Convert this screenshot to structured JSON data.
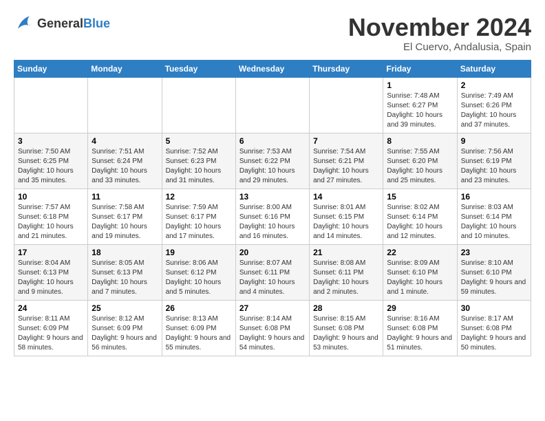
{
  "header": {
    "logo_general": "General",
    "logo_blue": "Blue",
    "month_year": "November 2024",
    "location": "El Cuervo, Andalusia, Spain"
  },
  "weekdays": [
    "Sunday",
    "Monday",
    "Tuesday",
    "Wednesday",
    "Thursday",
    "Friday",
    "Saturday"
  ],
  "weeks": [
    [
      {
        "day": "",
        "sunrise": "",
        "sunset": "",
        "daylight": ""
      },
      {
        "day": "",
        "sunrise": "",
        "sunset": "",
        "daylight": ""
      },
      {
        "day": "",
        "sunrise": "",
        "sunset": "",
        "daylight": ""
      },
      {
        "day": "",
        "sunrise": "",
        "sunset": "",
        "daylight": ""
      },
      {
        "day": "",
        "sunrise": "",
        "sunset": "",
        "daylight": ""
      },
      {
        "day": "1",
        "sunrise": "Sunrise: 7:48 AM",
        "sunset": "Sunset: 6:27 PM",
        "daylight": "Daylight: 10 hours and 39 minutes."
      },
      {
        "day": "2",
        "sunrise": "Sunrise: 7:49 AM",
        "sunset": "Sunset: 6:26 PM",
        "daylight": "Daylight: 10 hours and 37 minutes."
      }
    ],
    [
      {
        "day": "3",
        "sunrise": "Sunrise: 7:50 AM",
        "sunset": "Sunset: 6:25 PM",
        "daylight": "Daylight: 10 hours and 35 minutes."
      },
      {
        "day": "4",
        "sunrise": "Sunrise: 7:51 AM",
        "sunset": "Sunset: 6:24 PM",
        "daylight": "Daylight: 10 hours and 33 minutes."
      },
      {
        "day": "5",
        "sunrise": "Sunrise: 7:52 AM",
        "sunset": "Sunset: 6:23 PM",
        "daylight": "Daylight: 10 hours and 31 minutes."
      },
      {
        "day": "6",
        "sunrise": "Sunrise: 7:53 AM",
        "sunset": "Sunset: 6:22 PM",
        "daylight": "Daylight: 10 hours and 29 minutes."
      },
      {
        "day": "7",
        "sunrise": "Sunrise: 7:54 AM",
        "sunset": "Sunset: 6:21 PM",
        "daylight": "Daylight: 10 hours and 27 minutes."
      },
      {
        "day": "8",
        "sunrise": "Sunrise: 7:55 AM",
        "sunset": "Sunset: 6:20 PM",
        "daylight": "Daylight: 10 hours and 25 minutes."
      },
      {
        "day": "9",
        "sunrise": "Sunrise: 7:56 AM",
        "sunset": "Sunset: 6:19 PM",
        "daylight": "Daylight: 10 hours and 23 minutes."
      }
    ],
    [
      {
        "day": "10",
        "sunrise": "Sunrise: 7:57 AM",
        "sunset": "Sunset: 6:18 PM",
        "daylight": "Daylight: 10 hours and 21 minutes."
      },
      {
        "day": "11",
        "sunrise": "Sunrise: 7:58 AM",
        "sunset": "Sunset: 6:17 PM",
        "daylight": "Daylight: 10 hours and 19 minutes."
      },
      {
        "day": "12",
        "sunrise": "Sunrise: 7:59 AM",
        "sunset": "Sunset: 6:17 PM",
        "daylight": "Daylight: 10 hours and 17 minutes."
      },
      {
        "day": "13",
        "sunrise": "Sunrise: 8:00 AM",
        "sunset": "Sunset: 6:16 PM",
        "daylight": "Daylight: 10 hours and 16 minutes."
      },
      {
        "day": "14",
        "sunrise": "Sunrise: 8:01 AM",
        "sunset": "Sunset: 6:15 PM",
        "daylight": "Daylight: 10 hours and 14 minutes."
      },
      {
        "day": "15",
        "sunrise": "Sunrise: 8:02 AM",
        "sunset": "Sunset: 6:14 PM",
        "daylight": "Daylight: 10 hours and 12 minutes."
      },
      {
        "day": "16",
        "sunrise": "Sunrise: 8:03 AM",
        "sunset": "Sunset: 6:14 PM",
        "daylight": "Daylight: 10 hours and 10 minutes."
      }
    ],
    [
      {
        "day": "17",
        "sunrise": "Sunrise: 8:04 AM",
        "sunset": "Sunset: 6:13 PM",
        "daylight": "Daylight: 10 hours and 9 minutes."
      },
      {
        "day": "18",
        "sunrise": "Sunrise: 8:05 AM",
        "sunset": "Sunset: 6:13 PM",
        "daylight": "Daylight: 10 hours and 7 minutes."
      },
      {
        "day": "19",
        "sunrise": "Sunrise: 8:06 AM",
        "sunset": "Sunset: 6:12 PM",
        "daylight": "Daylight: 10 hours and 5 minutes."
      },
      {
        "day": "20",
        "sunrise": "Sunrise: 8:07 AM",
        "sunset": "Sunset: 6:11 PM",
        "daylight": "Daylight: 10 hours and 4 minutes."
      },
      {
        "day": "21",
        "sunrise": "Sunrise: 8:08 AM",
        "sunset": "Sunset: 6:11 PM",
        "daylight": "Daylight: 10 hours and 2 minutes."
      },
      {
        "day": "22",
        "sunrise": "Sunrise: 8:09 AM",
        "sunset": "Sunset: 6:10 PM",
        "daylight": "Daylight: 10 hours and 1 minute."
      },
      {
        "day": "23",
        "sunrise": "Sunrise: 8:10 AM",
        "sunset": "Sunset: 6:10 PM",
        "daylight": "Daylight: 9 hours and 59 minutes."
      }
    ],
    [
      {
        "day": "24",
        "sunrise": "Sunrise: 8:11 AM",
        "sunset": "Sunset: 6:09 PM",
        "daylight": "Daylight: 9 hours and 58 minutes."
      },
      {
        "day": "25",
        "sunrise": "Sunrise: 8:12 AM",
        "sunset": "Sunset: 6:09 PM",
        "daylight": "Daylight: 9 hours and 56 minutes."
      },
      {
        "day": "26",
        "sunrise": "Sunrise: 8:13 AM",
        "sunset": "Sunset: 6:09 PM",
        "daylight": "Daylight: 9 hours and 55 minutes."
      },
      {
        "day": "27",
        "sunrise": "Sunrise: 8:14 AM",
        "sunset": "Sunset: 6:08 PM",
        "daylight": "Daylight: 9 hours and 54 minutes."
      },
      {
        "day": "28",
        "sunrise": "Sunrise: 8:15 AM",
        "sunset": "Sunset: 6:08 PM",
        "daylight": "Daylight: 9 hours and 53 minutes."
      },
      {
        "day": "29",
        "sunrise": "Sunrise: 8:16 AM",
        "sunset": "Sunset: 6:08 PM",
        "daylight": "Daylight: 9 hours and 51 minutes."
      },
      {
        "day": "30",
        "sunrise": "Sunrise: 8:17 AM",
        "sunset": "Sunset: 6:08 PM",
        "daylight": "Daylight: 9 hours and 50 minutes."
      }
    ]
  ]
}
